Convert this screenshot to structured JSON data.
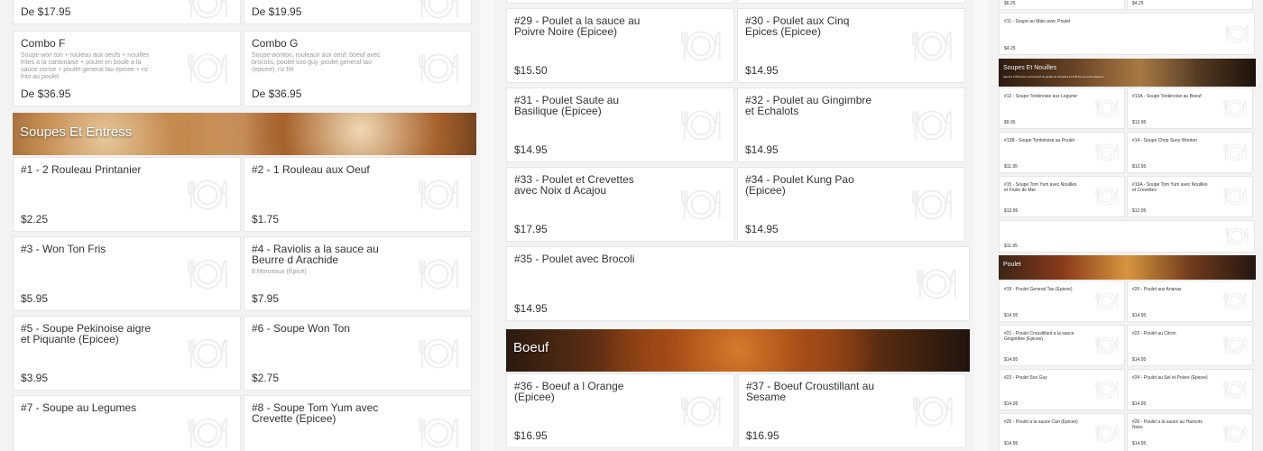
{
  "col1": {
    "top_prices": [
      "De $17.95",
      "De $19.95"
    ],
    "combos": [
      {
        "name": "Combo F",
        "desc": "Soupe won ton + rouleau aux oeufs + nouilles frites a la cantonaise + poulet en boule a la sauce cerise + poulet general tao epicee + riz frits au poulet",
        "price": "De $36.95"
      },
      {
        "name": "Combo G",
        "desc": "Soupe wonton, rouleaux aux oeuf, boeuf avec brocolis, poulet soo guy, poulet general tao (epicee), riz frit",
        "price": "De $36.95"
      }
    ],
    "section_title": "Soupes Et Entress",
    "items": [
      {
        "name": "#1 - 2 Rouleau Printanier",
        "desc": "",
        "price": "$2.25"
      },
      {
        "name": "#2 - 1 Rouleau aux Oeuf",
        "desc": "",
        "price": "$1.75"
      },
      {
        "name": "#3 - Won Ton Fris",
        "desc": "",
        "price": "$5.95"
      },
      {
        "name": "#4 - Raviolis a la sauce au Beurre d Arachide",
        "desc": "8 Morceaux (Épicé)",
        "price": "$7.95"
      },
      {
        "name": "#5 - Soupe Pekinoise aigre et Piquante (Epicee)",
        "desc": "",
        "price": "$3.95"
      },
      {
        "name": "#6 - Soupe Won Ton",
        "desc": "",
        "price": "$2.75"
      },
      {
        "name": "#7 - Soupe au Legumes",
        "desc": "",
        "price": ""
      },
      {
        "name": "#8 - Soupe Tom Yum avec Crevette (Epicee)",
        "desc": "",
        "price": ""
      }
    ]
  },
  "col2": {
    "items": [
      {
        "name": "#29 - Poulet a la sauce au Poivre Noire (Epicee)",
        "price": "$15.50"
      },
      {
        "name": "#30 - Poulet aux Cinq Epices (Epicee)",
        "price": "$14.95"
      },
      {
        "name": "#31 - Poulet Saute au Basilique (Epicee)",
        "price": "$14.95"
      },
      {
        "name": "#32 - Poulet au Gingimbre et Echalots",
        "price": "$14.95"
      },
      {
        "name": "#33 - Poulet et Crevettes avec Noix d Acajou",
        "price": "$17.95"
      },
      {
        "name": "#34 - Poulet Kung Pao (Epicee)",
        "price": "$14.95"
      },
      {
        "name": "#35 - Poulet avec Brocoli",
        "price": "$14.95"
      }
    ],
    "section_title": "Boeuf",
    "beef_items": [
      {
        "name": "#36 - Boeuf a l Orange (Epicee)",
        "price": "$16.95"
      },
      {
        "name": "#37 - Boeuf Croustillant au Sesame",
        "price": "$16.95"
      }
    ]
  },
  "col3": {
    "top_prices": [
      "$6.25",
      "$4.25"
    ],
    "top_item": {
      "name": "#11 - Soupe au Mais avec Poulet",
      "price": "$4.25"
    },
    "noodle_title": "Soupes Et Nouilles",
    "noodle_sub": "Ajoutez 2.00 $ pour extra boeuf ou poulet ou crevettes et 3.00 $ pour extra legumes",
    "noodle_items": [
      {
        "name": "#12 - Soupe Tonkinoise aux Legume",
        "price": "$9.95"
      },
      {
        "name": "#13A - Soupe Tonkinoise au Boeuf",
        "price": "$13.95"
      },
      {
        "name": "#13B - Soupe Tonkinoise au Poulet",
        "price": "$11.95"
      },
      {
        "name": "#14 - Soupe Chop Suey Wonton",
        "price": "$12.95"
      },
      {
        "name": "#15 - Soupe Tom Yum avec Nouilles et Fruits de Mer",
        "price": "$13.95"
      },
      {
        "name": "#16A - Soupe Tom Yum avec Nouilles et Crevettes",
        "price": "$12.95"
      }
    ],
    "orphan_price": "$11.95",
    "chicken_title": "Poulet",
    "chicken_items": [
      {
        "name": "#19 - Poulet General Tao (Epicee)",
        "price": "$14.95"
      },
      {
        "name": "#20 - Poulet aux Ananas",
        "price": "$14.95"
      },
      {
        "name": "#21 - Poulet Croustillant a la sauce Gingimbre (Epicee)",
        "price": "$14.95"
      },
      {
        "name": "#22 - Poulet au Citron",
        "price": "$14.95"
      },
      {
        "name": "#23 - Poulet Soo Guy",
        "price": "$14.95"
      },
      {
        "name": "#24 - Poulet au Sel et Poivre (Epicee)",
        "price": "$14.95"
      },
      {
        "name": "#25 - Poulet a la sauce Cari (Epicee)",
        "price": "$14.95"
      },
      {
        "name": "#26 - Poulet a la sauce au Haricots Noirs",
        "price": "$14.95"
      }
    ]
  }
}
